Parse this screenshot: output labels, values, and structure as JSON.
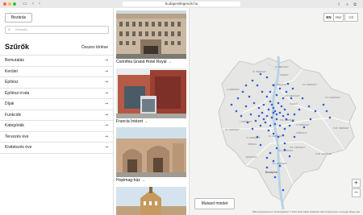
{
  "browser": {
    "url": "budapestlegends.hu"
  },
  "sidebar": {
    "close_label": "Bezárás",
    "search_placeholder": "Keresés",
    "title": "Szűrők",
    "clear_all": "Összes törlése",
    "filters": [
      {
        "label": "Bemutatás"
      },
      {
        "label": "Kerület"
      },
      {
        "label": "Építész"
      },
      {
        "label": "Építészi iroda"
      },
      {
        "label": "Díjak"
      },
      {
        "label": "Funkciók"
      },
      {
        "label": "Kategóriák"
      },
      {
        "label": "Tervezés éve"
      },
      {
        "label": "Kivitelezés éve"
      }
    ]
  },
  "cards": [
    {
      "label": "Corinthia Grand Hotel Royal →"
    },
    {
      "label": "Francia Intézet →"
    },
    {
      "label": "Hopimag-ház →"
    },
    {
      "label": ""
    }
  ],
  "map": {
    "languages": [
      "EN",
      "HU",
      "DE"
    ],
    "show_all_label": "Mutasd mindet",
    "zoom_in": "+",
    "zoom_out": "−",
    "attribution": "Billentyűparancsok   Térképadatok © 2022   Használati feltételek   Hiba bejelentése a Google Maps-nek",
    "google": "Google",
    "districts": [
      {
        "name": "III. KERÜLET"
      },
      {
        "name": "IV. KERÜLET"
      },
      {
        "name": "ÚJPEST"
      },
      {
        "name": "II. KERÜLET"
      },
      {
        "name": "XIII. KERÜLET"
      },
      {
        "name": "XV. KERÜLET"
      },
      {
        "name": "XIV. KERÜLET"
      },
      {
        "name": "XVI. KERÜLET"
      },
      {
        "name": "ZUGLÓ"
      },
      {
        "name": "I. KERÜLET"
      },
      {
        "name": "VIII. KERÜLET"
      },
      {
        "name": "XII. KERÜLET"
      },
      {
        "name": "X. KERÜLET"
      },
      {
        "name": "XI. KERÜLET"
      },
      {
        "name": "KŐBÁNYA"
      },
      {
        "name": "XVII. KERÜLET"
      },
      {
        "name": "IX. KERÜLET"
      },
      {
        "name": "XIX. KERÜLET"
      },
      {
        "name": "ÚJBUDA"
      },
      {
        "name": "XX. KERÜLET"
      },
      {
        "name": "XVIII. KERÜLET"
      },
      {
        "name": "BUDAFOK"
      },
      {
        "name": "XXI. KERÜLET"
      },
      {
        "name": "Budapest"
      }
    ]
  },
  "colors": {
    "marker": "#2f5fd6",
    "map_fill": "#e6e6e4",
    "map_border": "#ffffff"
  }
}
